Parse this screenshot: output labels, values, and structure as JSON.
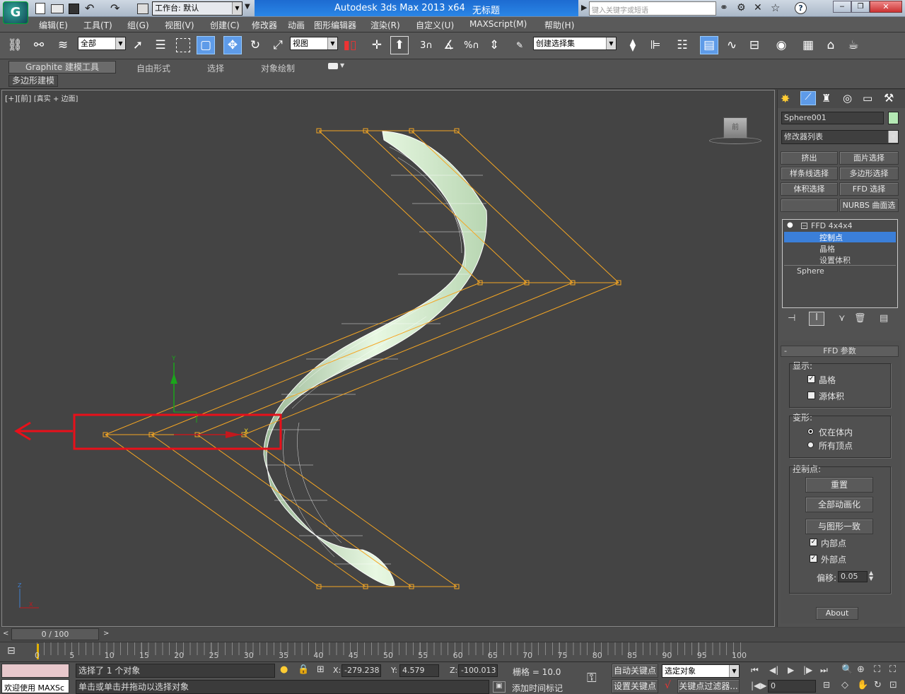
{
  "title": {
    "workspace": "工作台: 默认",
    "app": "Autodesk 3ds Max  2013 x64",
    "doc": "无标题",
    "search_placeholder": "键入关键字或短语"
  },
  "menu": [
    "编辑(E)",
    "工具(T)",
    "组(G)",
    "视图(V)",
    "创建(C)",
    "修改器",
    "动画",
    "图形编辑器",
    "渲染(R)",
    "自定义(U)",
    "MAXScript(M)",
    "帮助(H)"
  ],
  "toolbar": {
    "filter": "全部",
    "refcoord": "视图",
    "named_selection": "创建选择集",
    "snap_angle": "3",
    "snap_percent": "%"
  },
  "ribbon": {
    "tabs": [
      "Graphite 建模工具",
      "自由形式",
      "选择",
      "对象绘制"
    ],
    "subtab": "多边形建模"
  },
  "viewport": {
    "label_plus": "[+]",
    "label_view": "[前]",
    "label_shading": "[真实 + 边面]",
    "viewcube_face": "前"
  },
  "panel": {
    "object_name": "Sphere001",
    "object_color": "#b4e8b4",
    "modifier_list": "修改器列表",
    "quick_buttons": [
      "挤出",
      "面片选择",
      "样条线选择",
      "多边形选择",
      "体积选择",
      "FFD 选择",
      "",
      "NURBS 曲面选择"
    ],
    "stack": {
      "modifier": "FFD 4x4x4",
      "subs": [
        "控制点",
        "晶格",
        "设置体积"
      ],
      "base": "Sphere"
    },
    "rollout_title": "FFD 参数",
    "display_label": "显示:",
    "display_lattice": "晶格",
    "display_source": "源体积",
    "deform_label": "变形:",
    "deform_inside": "仅在体内",
    "deform_all": "所有顶点",
    "cp_label": "控制点:",
    "btn_reset": "重置",
    "btn_animate_all": "全部动画化",
    "btn_conform": "与图形一致",
    "inside_points": "内部点",
    "outside_points": "外部点",
    "offset_label": "偏移:",
    "offset_value": "0.05",
    "about": "About"
  },
  "timeline": {
    "frame": "0 / 100",
    "ticks": [
      "0",
      "5",
      "10",
      "15",
      "20",
      "25",
      "30",
      "35",
      "40",
      "45",
      "50",
      "55",
      "60",
      "65",
      "70",
      "75",
      "80",
      "85",
      "90",
      "95",
      "100"
    ]
  },
  "status": {
    "selected": "选择了 1 个对象",
    "prompt": "单击或单击并拖动以选择对象",
    "welcome": "欢迎使用 MAXSc",
    "x_label": "X:",
    "x": "-279.238",
    "y_label": "Y:",
    "y": "4.579",
    "z_label": "Z:",
    "z": "-100.013",
    "grid": "栅格 = 10.0",
    "autokey": "自动关键点",
    "setkey": "设置关键点",
    "selected_obj": "选定对象",
    "key_filters": "关键点过滤器...",
    "add_time_tag": "添加时间标记",
    "frame_field": "0"
  },
  "colors": {
    "lattice": "#f5a623",
    "highlight_box": "#e8101a",
    "mesh": "#d8f0d0",
    "selected_row": "#3b7fd9"
  }
}
